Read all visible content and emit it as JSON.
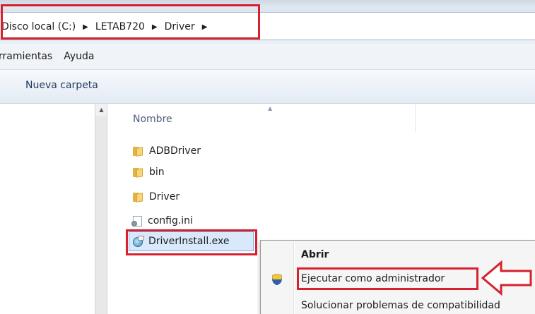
{
  "address_bar": {
    "crumbs": [
      "Disco local (C:)",
      "LETAB720",
      "Driver"
    ],
    "separator": "▶"
  },
  "menu_bar": {
    "items": [
      "rramientas",
      "Ayuda"
    ]
  },
  "toolbar": {
    "new_folder_label": "Nueva carpeta"
  },
  "file_list": {
    "column_name": "Nombre",
    "items": [
      {
        "name": "ADBDriver",
        "type": "folder"
      },
      {
        "name": "bin",
        "type": "folder"
      },
      {
        "name": "Driver",
        "type": "folder"
      },
      {
        "name": "config.ini",
        "type": "ini"
      },
      {
        "name": "DriverInstall.exe",
        "type": "exe",
        "selected": true
      }
    ]
  },
  "context_menu": {
    "items": [
      {
        "label": "Abrir",
        "bold": true
      },
      {
        "label": "Ejecutar como administrador",
        "icon": "uac-shield-icon"
      },
      {
        "label": "Solucionar problemas de compatibilidad"
      }
    ]
  },
  "colors": {
    "highlight_red": "#d7212e",
    "selection_blue": "#d8e9fb",
    "selection_border": "#7fb0e6"
  }
}
